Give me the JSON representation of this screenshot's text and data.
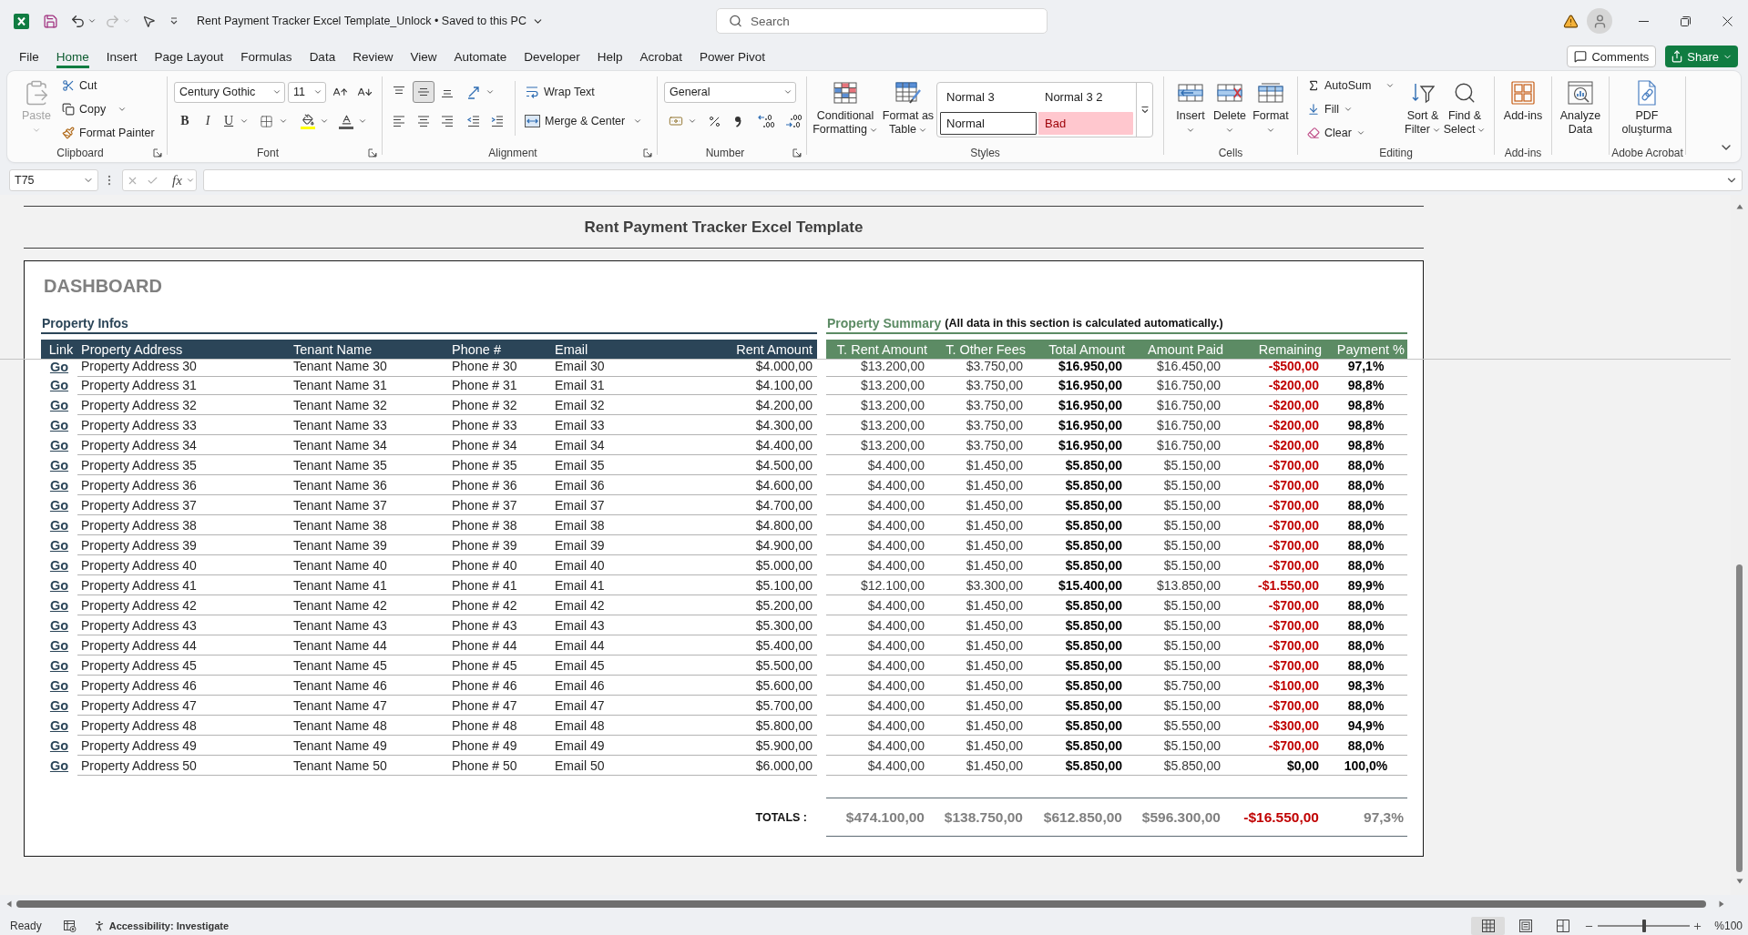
{
  "title_bar": {
    "quick_access": [
      {
        "kind": "save",
        "disabled": false
      },
      {
        "kind": "undo",
        "disabled": false
      },
      {
        "kind": "redo",
        "disabled": true
      },
      {
        "kind": "pointer",
        "disabled": false
      }
    ],
    "document_title": "Rent Payment Tracker Excel Template_Unlock • Saved to this PC",
    "search": {
      "placeholder": "Search"
    }
  },
  "menu_tabs": [
    {
      "label": "File",
      "selected": false
    },
    {
      "label": "Home",
      "selected": true
    },
    {
      "label": "Insert",
      "selected": false
    },
    {
      "label": "Page Layout",
      "selected": false
    },
    {
      "label": "Formulas",
      "selected": false
    },
    {
      "label": "Data",
      "selected": false
    },
    {
      "label": "Review",
      "selected": false
    },
    {
      "label": "View",
      "selected": false
    },
    {
      "label": "Automate",
      "selected": false
    },
    {
      "label": "Developer",
      "selected": false
    },
    {
      "label": "Help",
      "selected": false
    },
    {
      "label": "Acrobat",
      "selected": false
    },
    {
      "label": "Power Pivot",
      "selected": false
    }
  ],
  "comments_button": "Comments",
  "share_button": "Share",
  "ribbon": {
    "clipboard": {
      "label": "Clipboard",
      "paste": {
        "label": "Paste",
        "disabled": true
      },
      "cut": "Cut",
      "copy": "Copy",
      "format_painter": "Format Painter"
    },
    "font": {
      "label": "Font",
      "font_name": "Century Gothic",
      "font_size": "11",
      "styles": [
        {
          "kind": "bold",
          "label": "B"
        },
        {
          "kind": "italic",
          "label": "I"
        },
        {
          "kind": "underline",
          "label": "U"
        }
      ]
    },
    "alignment": {
      "label": "Alignment",
      "vertical": [
        {
          "kind": "top",
          "selected": false
        },
        {
          "kind": "middle",
          "selected": true
        },
        {
          "kind": "bottom",
          "selected": false
        }
      ],
      "horizontal": [
        {
          "kind": "left",
          "selected": false
        },
        {
          "kind": "center",
          "selected": false
        },
        {
          "kind": "right",
          "selected": false
        }
      ],
      "wrap_text": "Wrap Text",
      "merge_center": "Merge & Center"
    },
    "number": {
      "label": "Number",
      "format": "General"
    },
    "styles": {
      "label": "Styles",
      "conditional_formatting": [
        "Conditional",
        "Formatting"
      ],
      "format_as_table": [
        "Format as",
        "Table"
      ],
      "gallery": [
        {
          "label": "Normal 3",
          "kind": "plain",
          "selected": false
        },
        {
          "label": "Normal 3 2",
          "kind": "plain",
          "selected": false
        },
        {
          "label": "Normal",
          "kind": "plain",
          "selected": true
        },
        {
          "label": "Bad",
          "kind": "bad",
          "selected": false
        }
      ]
    },
    "cells": {
      "label": "Cells",
      "buttons": [
        {
          "kind": "insert",
          "label": "Insert"
        },
        {
          "kind": "delete",
          "label": "Delete"
        },
        {
          "kind": "format",
          "label": "Format"
        }
      ]
    },
    "editing": {
      "label": "Editing",
      "autosum": "AutoSum",
      "fill": "Fill",
      "clear": "Clear",
      "sort_filter": [
        "Sort &",
        "Filter"
      ],
      "find_select": [
        "Find &",
        "Select"
      ]
    },
    "add_ins": {
      "label": "Add-ins",
      "button": [
        "Add-ins"
      ]
    },
    "analyze_data": {
      "button": [
        "Analyze",
        "Data"
      ]
    },
    "adobe_acrobat": {
      "label": "Adobe Acrobat",
      "button": [
        "PDF",
        "oluşturma"
      ]
    }
  },
  "formula_bar": {
    "name_box": "T75",
    "function_label": "fx"
  },
  "sheet": {
    "title": "Rent Payment Tracker Excel Template",
    "dashboard": {
      "heading": "DASHBOARD",
      "property_infos": {
        "title": "Property Infos",
        "columns": [
          "Link",
          "Property Address",
          "Tenant Name",
          "Phone #",
          "Email",
          "Rent Amount"
        ],
        "rows": [
          {
            "link": "Go",
            "address": "Property Address 30",
            "tenant": "Tenant Name 30",
            "phone": "Phone # 30",
            "email": "Email 30",
            "rent": "$4.000,00"
          },
          {
            "link": "Go",
            "address": "Property Address 31",
            "tenant": "Tenant Name 31",
            "phone": "Phone # 31",
            "email": "Email 31",
            "rent": "$4.100,00"
          },
          {
            "link": "Go",
            "address": "Property Address 32",
            "tenant": "Tenant Name 32",
            "phone": "Phone # 32",
            "email": "Email 32",
            "rent": "$4.200,00"
          },
          {
            "link": "Go",
            "address": "Property Address 33",
            "tenant": "Tenant Name 33",
            "phone": "Phone # 33",
            "email": "Email 33",
            "rent": "$4.300,00"
          },
          {
            "link": "Go",
            "address": "Property Address 34",
            "tenant": "Tenant Name 34",
            "phone": "Phone # 34",
            "email": "Email 34",
            "rent": "$4.400,00"
          },
          {
            "link": "Go",
            "address": "Property Address 35",
            "tenant": "Tenant Name 35",
            "phone": "Phone # 35",
            "email": "Email 35",
            "rent": "$4.500,00"
          },
          {
            "link": "Go",
            "address": "Property Address 36",
            "tenant": "Tenant Name 36",
            "phone": "Phone # 36",
            "email": "Email 36",
            "rent": "$4.600,00"
          },
          {
            "link": "Go",
            "address": "Property Address 37",
            "tenant": "Tenant Name 37",
            "phone": "Phone # 37",
            "email": "Email 37",
            "rent": "$4.700,00"
          },
          {
            "link": "Go",
            "address": "Property Address 38",
            "tenant": "Tenant Name 38",
            "phone": "Phone # 38",
            "email": "Email 38",
            "rent": "$4.800,00"
          },
          {
            "link": "Go",
            "address": "Property Address 39",
            "tenant": "Tenant Name 39",
            "phone": "Phone # 39",
            "email": "Email 39",
            "rent": "$4.900,00"
          },
          {
            "link": "Go",
            "address": "Property Address 40",
            "tenant": "Tenant Name 40",
            "phone": "Phone # 40",
            "email": "Email 40",
            "rent": "$5.000,00"
          },
          {
            "link": "Go",
            "address": "Property Address 41",
            "tenant": "Tenant Name 41",
            "phone": "Phone # 41",
            "email": "Email 41",
            "rent": "$5.100,00"
          },
          {
            "link": "Go",
            "address": "Property Address 42",
            "tenant": "Tenant Name 42",
            "phone": "Phone # 42",
            "email": "Email 42",
            "rent": "$5.200,00"
          },
          {
            "link": "Go",
            "address": "Property Address 43",
            "tenant": "Tenant Name 43",
            "phone": "Phone # 43",
            "email": "Email 43",
            "rent": "$5.300,00"
          },
          {
            "link": "Go",
            "address": "Property Address 44",
            "tenant": "Tenant Name 44",
            "phone": "Phone # 44",
            "email": "Email 44",
            "rent": "$5.400,00"
          },
          {
            "link": "Go",
            "address": "Property Address 45",
            "tenant": "Tenant Name 45",
            "phone": "Phone # 45",
            "email": "Email 45",
            "rent": "$5.500,00"
          },
          {
            "link": "Go",
            "address": "Property Address 46",
            "tenant": "Tenant Name 46",
            "phone": "Phone # 46",
            "email": "Email 46",
            "rent": "$5.600,00"
          },
          {
            "link": "Go",
            "address": "Property Address 47",
            "tenant": "Tenant Name 47",
            "phone": "Phone # 47",
            "email": "Email 47",
            "rent": "$5.700,00"
          },
          {
            "link": "Go",
            "address": "Property Address 48",
            "tenant": "Tenant Name 48",
            "phone": "Phone # 48",
            "email": "Email 48",
            "rent": "$5.800,00"
          },
          {
            "link": "Go",
            "address": "Property Address 49",
            "tenant": "Tenant Name 49",
            "phone": "Phone # 49",
            "email": "Email 49",
            "rent": "$5.900,00"
          },
          {
            "link": "Go",
            "address": "Property Address 50",
            "tenant": "Tenant Name 50",
            "phone": "Phone # 50",
            "email": "Email 50",
            "rent": "$6.000,00"
          }
        ]
      },
      "property_summary": {
        "title": "Property Summary",
        "note": "(All data in this section is calculated automatically.)",
        "columns": [
          "T. Rent Amount",
          "T. Other Fees",
          "Total Amount",
          "Amount Paid",
          "Remaining",
          "Payment %"
        ],
        "rows": [
          {
            "total_rent": "$13.200,00",
            "other_fees": "$3.750,00",
            "total": "$16.950,00",
            "paid": "$16.450,00",
            "remaining": "-$500,00",
            "overdue": true,
            "payment": "97,1%"
          },
          {
            "total_rent": "$13.200,00",
            "other_fees": "$3.750,00",
            "total": "$16.950,00",
            "paid": "$16.750,00",
            "remaining": "-$200,00",
            "overdue": true,
            "payment": "98,8%"
          },
          {
            "total_rent": "$13.200,00",
            "other_fees": "$3.750,00",
            "total": "$16.950,00",
            "paid": "$16.750,00",
            "remaining": "-$200,00",
            "overdue": true,
            "payment": "98,8%"
          },
          {
            "total_rent": "$13.200,00",
            "other_fees": "$3.750,00",
            "total": "$16.950,00",
            "paid": "$16.750,00",
            "remaining": "-$200,00",
            "overdue": true,
            "payment": "98,8%"
          },
          {
            "total_rent": "$13.200,00",
            "other_fees": "$3.750,00",
            "total": "$16.950,00",
            "paid": "$16.750,00",
            "remaining": "-$200,00",
            "overdue": true,
            "payment": "98,8%"
          },
          {
            "total_rent": "$4.400,00",
            "other_fees": "$1.450,00",
            "total": "$5.850,00",
            "paid": "$5.150,00",
            "remaining": "-$700,00",
            "overdue": true,
            "payment": "88,0%"
          },
          {
            "total_rent": "$4.400,00",
            "other_fees": "$1.450,00",
            "total": "$5.850,00",
            "paid": "$5.150,00",
            "remaining": "-$700,00",
            "overdue": true,
            "payment": "88,0%"
          },
          {
            "total_rent": "$4.400,00",
            "other_fees": "$1.450,00",
            "total": "$5.850,00",
            "paid": "$5.150,00",
            "remaining": "-$700,00",
            "overdue": true,
            "payment": "88,0%"
          },
          {
            "total_rent": "$4.400,00",
            "other_fees": "$1.450,00",
            "total": "$5.850,00",
            "paid": "$5.150,00",
            "remaining": "-$700,00",
            "overdue": true,
            "payment": "88,0%"
          },
          {
            "total_rent": "$4.400,00",
            "other_fees": "$1.450,00",
            "total": "$5.850,00",
            "paid": "$5.150,00",
            "remaining": "-$700,00",
            "overdue": true,
            "payment": "88,0%"
          },
          {
            "total_rent": "$4.400,00",
            "other_fees": "$1.450,00",
            "total": "$5.850,00",
            "paid": "$5.150,00",
            "remaining": "-$700,00",
            "overdue": true,
            "payment": "88,0%"
          },
          {
            "total_rent": "$12.100,00",
            "other_fees": "$3.300,00",
            "total": "$15.400,00",
            "paid": "$13.850,00",
            "remaining": "-$1.550,00",
            "overdue": true,
            "payment": "89,9%"
          },
          {
            "total_rent": "$4.400,00",
            "other_fees": "$1.450,00",
            "total": "$5.850,00",
            "paid": "$5.150,00",
            "remaining": "-$700,00",
            "overdue": true,
            "payment": "88,0%"
          },
          {
            "total_rent": "$4.400,00",
            "other_fees": "$1.450,00",
            "total": "$5.850,00",
            "paid": "$5.150,00",
            "remaining": "-$700,00",
            "overdue": true,
            "payment": "88,0%"
          },
          {
            "total_rent": "$4.400,00",
            "other_fees": "$1.450,00",
            "total": "$5.850,00",
            "paid": "$5.150,00",
            "remaining": "-$700,00",
            "overdue": true,
            "payment": "88,0%"
          },
          {
            "total_rent": "$4.400,00",
            "other_fees": "$1.450,00",
            "total": "$5.850,00",
            "paid": "$5.150,00",
            "remaining": "-$700,00",
            "overdue": true,
            "payment": "88,0%"
          },
          {
            "total_rent": "$4.400,00",
            "other_fees": "$1.450,00",
            "total": "$5.850,00",
            "paid": "$5.750,00",
            "remaining": "-$100,00",
            "overdue": true,
            "payment": "98,3%"
          },
          {
            "total_rent": "$4.400,00",
            "other_fees": "$1.450,00",
            "total": "$5.850,00",
            "paid": "$5.150,00",
            "remaining": "-$700,00",
            "overdue": true,
            "payment": "88,0%"
          },
          {
            "total_rent": "$4.400,00",
            "other_fees": "$1.450,00",
            "total": "$5.850,00",
            "paid": "$5.550,00",
            "remaining": "-$300,00",
            "overdue": true,
            "payment": "94,9%"
          },
          {
            "total_rent": "$4.400,00",
            "other_fees": "$1.450,00",
            "total": "$5.850,00",
            "paid": "$5.150,00",
            "remaining": "-$700,00",
            "overdue": true,
            "payment": "88,0%"
          },
          {
            "total_rent": "$4.400,00",
            "other_fees": "$1.450,00",
            "total": "$5.850,00",
            "paid": "$5.850,00",
            "remaining": "$0,00",
            "overdue": false,
            "payment": "100,0%"
          }
        ]
      },
      "totals": {
        "label": "TOTALS :",
        "total_rent": "$474.100,00",
        "other_fees": "$138.750,00",
        "total": "$612.850,00",
        "paid": "$596.300,00",
        "remaining": "-$16.550,00",
        "overdue": true,
        "payment": "97,3%"
      }
    }
  },
  "status_bar": {
    "mode": "Ready",
    "accessibility": "Accessibility: Investigate",
    "views": [
      {
        "kind": "normal",
        "selected": true
      },
      {
        "kind": "page_layout",
        "selected": false
      },
      {
        "kind": "page_break",
        "selected": false
      }
    ],
    "zoom": {
      "level": 0.5,
      "reading": "%100"
    }
  }
}
